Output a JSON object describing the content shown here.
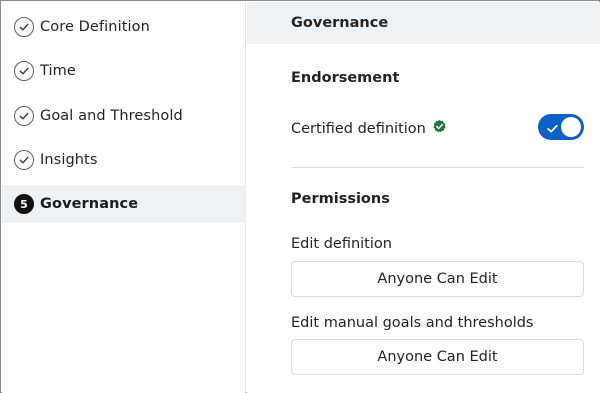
{
  "sidebar": {
    "steps": [
      {
        "label": "Core Definition",
        "status": "complete"
      },
      {
        "label": "Time",
        "status": "complete"
      },
      {
        "label": "Goal and Threshold",
        "status": "complete"
      },
      {
        "label": "Insights",
        "status": "complete"
      },
      {
        "label": "Governance",
        "status": "current",
        "number": "5"
      }
    ]
  },
  "main": {
    "header_title": "Governance",
    "endorsement": {
      "title": "Endorsement",
      "certified_label": "Certified definition",
      "certified_on": true
    },
    "permissions": {
      "title": "Permissions",
      "edit_definition_label": "Edit definition",
      "edit_definition_value": "Anyone Can Edit",
      "edit_goals_label": "Edit manual goals and thresholds",
      "edit_goals_value": "Anyone Can Edit"
    }
  },
  "colors": {
    "accent": "#0f5fc9",
    "verified_badge": "#1e7a3c",
    "active_row_bg": "#eef2f4"
  },
  "icons": {
    "complete_step": "check-circle-icon",
    "certified": "verified-badge-icon",
    "toggle_on": "checkmark-icon"
  }
}
